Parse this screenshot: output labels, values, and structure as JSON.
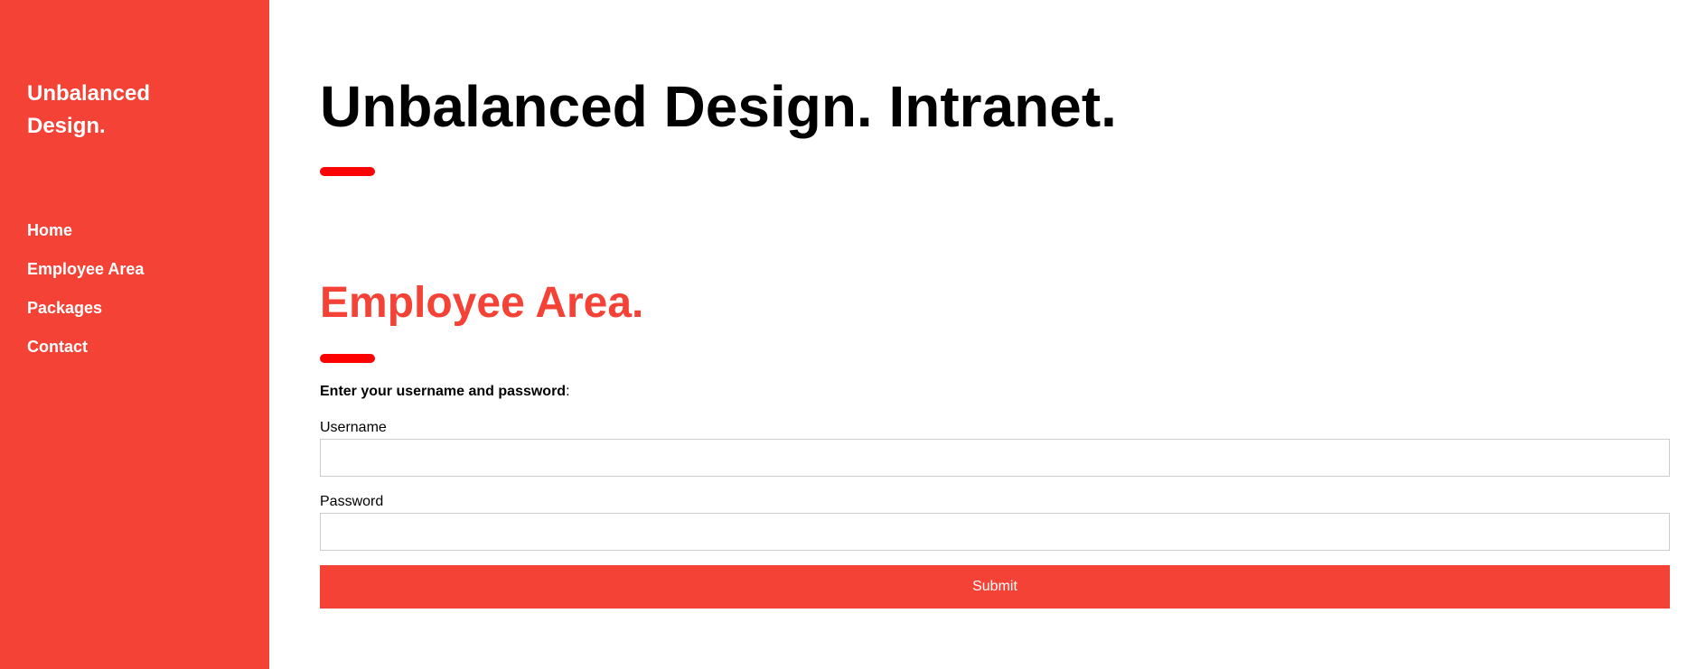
{
  "sidebar": {
    "brand": "Unbalanced Design.",
    "nav": [
      {
        "label": "Home"
      },
      {
        "label": "Employee Area"
      },
      {
        "label": "Packages"
      },
      {
        "label": "Contact"
      }
    ]
  },
  "main": {
    "title": "Unbalanced Design. Intranet.",
    "section_title": "Employee Area.",
    "instruction_bold": "Enter your username and password",
    "instruction_suffix": ":",
    "form": {
      "username_label": "Username",
      "username_value": "",
      "password_label": "Password",
      "password_value": "",
      "submit_label": "Submit"
    }
  },
  "colors": {
    "accent": "#f44336",
    "divider": "#ff0000",
    "text": "#000000",
    "sidebar_text": "#ffffff"
  }
}
